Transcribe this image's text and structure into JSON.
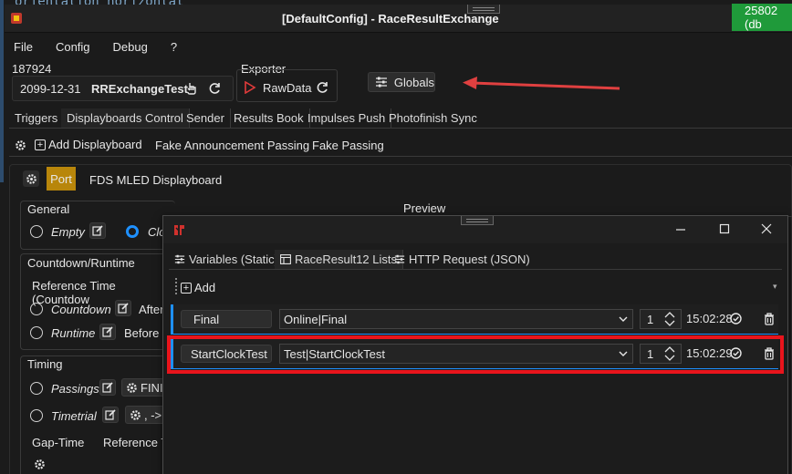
{
  "bg_code": "orientation  horizontal",
  "window": {
    "title": "[DefaultConfig] - RaceResultExchange",
    "status_badge": "25802 (db"
  },
  "menu": [
    "File",
    "Config",
    "Debug",
    "?"
  ],
  "session": {
    "id": "187924",
    "date": "2099-12-31",
    "name": "RRExchangeTest"
  },
  "exporter": {
    "label": "Exporter",
    "name": "RawData"
  },
  "globals_label": "Globals",
  "tabs": [
    "Triggers",
    "Displayboards Control",
    "Sender",
    "Results Book",
    "Impulses Push",
    "Photofinish Sync"
  ],
  "toolbar": {
    "add": "Add Displayboard",
    "fake_announce": "Fake Announcement Passing",
    "fake_passing": "Fake Passing"
  },
  "board": {
    "port": "Port",
    "name": "FDS MLED Displayboard"
  },
  "general": {
    "title": "General",
    "empty": "Empty",
    "clock_partial": "Clo"
  },
  "preview_label": "Preview",
  "countdown": {
    "title": "Countdown/Runtime",
    "ref_time": "Reference Time (Countdow",
    "countdown": "Countdown",
    "after": "After",
    "runtime": "Runtime",
    "before": "Before"
  },
  "timing": {
    "title": "Timing",
    "passings": "Passings",
    "finis": "FINIS",
    "timetrial": "Timetrial",
    "arrow": ", ->",
    "gap_time": "Gap-Time",
    "ref_ti": "Reference Ti"
  },
  "popup": {
    "tabs": [
      "Variables (Static)",
      "RaceResult12 Lists",
      "HTTP Request (JSON)"
    ],
    "add": "Add",
    "rows": [
      {
        "name": "Final",
        "list": "Online|Final",
        "count": "1",
        "time": "15:02:28"
      },
      {
        "name": "StartClockTest",
        "list": "Test|StartClockTest",
        "count": "1",
        "time": "15:02:29"
      }
    ]
  },
  "colors": {
    "accent_blue": "#1e90ff",
    "highlight_red": "#e8141c",
    "port_orange": "#b8860b",
    "badge_green": "#1f9a3a",
    "arrow_red": "#e04040"
  }
}
